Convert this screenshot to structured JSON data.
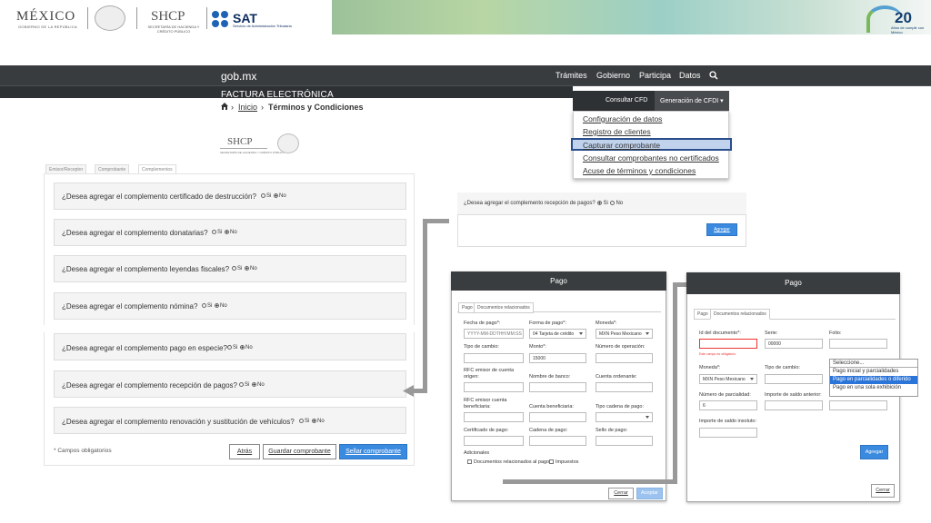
{
  "header": {
    "mexico": "MÉXICO",
    "mexico_sub": "GOBIERNO DE LA REPÚBLICA",
    "shcp": "SHCP",
    "shcp_sub": "SECRETARÍA DE HACIENDA Y CRÉDITO PÚBLICO",
    "sat": "SAT",
    "sat_sub": "Servicio de Administración Tributaria",
    "badge_num": "20",
    "badge_sub": "Años de cumplir con México"
  },
  "nav": {
    "brand": "gob.mx",
    "items": [
      "Trámites",
      "Gobierno",
      "Participa",
      "Datos"
    ],
    "subtitle": "FACTURA ELECTRÓNICA",
    "consultar": "Consultar CFD",
    "generacion": "Generación de CFDI ▾"
  },
  "breadcrumb": {
    "home": "Inicio",
    "current": "Términos y Condiciones"
  },
  "menu": {
    "items": [
      "Configuración de datos",
      "Registro de clientes",
      "Capturar comprobante",
      "Consultar comprobantes no certificados",
      "Acuse de términos y condiciones"
    ]
  },
  "small_logo": {
    "shcp": "SHCP",
    "sub": "SECRETARÍA DE HACIENDA Y CRÉDITO PÚBLICO"
  },
  "left_form": {
    "tabs": [
      "Emisor/Receptor",
      "Comprobante",
      "Complementos"
    ],
    "questions": [
      "¿Desea agregar el complemento certificado de destrucción?",
      "¿Desea agregar el complemento donatarias?",
      "¿Desea agregar el complemento leyendas fiscales?",
      "¿Desea agregar el complemento nómina?",
      "¿Desea agregar el complemento pago en especie?",
      "¿Desea agregar el complemento recepción de pagos?",
      "¿Desea agregar el complemento renovación y sustitución de vehículos?"
    ],
    "si": "Si",
    "no": "No",
    "required": "* Campos obligatorios",
    "btn_atras": "Atrás",
    "btn_guardar": "Guardar comprobante",
    "btn_sellar": "Sellar comprobante"
  },
  "recepcion": {
    "question": "¿Desea agregar el complemento recepción de pagos?",
    "si": "Si",
    "no": "No",
    "agregar": "Agregar"
  },
  "pago1": {
    "title": "Pago",
    "tabs": [
      "Pago",
      "Documentos relacionados"
    ],
    "fields": {
      "fecha_label": "Fecha de pago*:",
      "fecha_ph": "YYYY-MM-DDTHH:MM:SS",
      "forma_label": "Forma de pago*:",
      "forma_val": "04 Tarjeta de crédito",
      "moneda_label": "Moneda*:",
      "moneda_val": "MXN Peso Mexicano",
      "tipo_cambio_label": "Tipo de cambio:",
      "monto_label": "Monto*:",
      "monto_val": "15000",
      "num_op_label": "Número de operación:",
      "rfc_origen_label": "RFC emisor de cuenta origen:",
      "banco_label": "Nombre de banco:",
      "cuenta_ord_label": "Cuenta ordenante:",
      "rfc_benef_label": "RFC emisor cuenta beneficiaria:",
      "cuenta_benef_label": "Cuenta beneficiaria:",
      "tipo_cadena_label": "Tipo cadena de pago:",
      "cert_label": "Certificado de pago:",
      "cadena_label": "Cadena de pago:",
      "sello_label": "Sello de pago:"
    },
    "adicionales": "Adicionales",
    "chk_docs": "Documentos relacionados al pago",
    "chk_imp": "Impuestos",
    "cerrar": "Cerrar",
    "aceptar": "Aceptar"
  },
  "pago2": {
    "title": "Pago",
    "tabs": [
      "Pago",
      "Documentos relacionados"
    ],
    "id_doc_label": "Id del documento*:",
    "id_doc_hint": "Este campo es obligatorio",
    "serie_label": "Serie:",
    "serie_val": "00000",
    "folio_label": "Folio:",
    "moneda_label": "Moneda*:",
    "moneda_val": "MXN Peso Mexicano",
    "tipo_cambio_label": "Tipo de cambio:",
    "num_parc_label": "Número de parcialidad:",
    "num_parc_val": "6",
    "saldo_ant_label": "Importe de saldo anterior:",
    "saldo_ins_label": "Importe de saldo insoluto:",
    "agregar": "Agregar",
    "cerrar": "Cerrar",
    "options": [
      "Seleccione...",
      "Pago inicial y parcialidades",
      "Pago en parcialidades o diferido",
      "Pago en una sola exhibición"
    ],
    "selected_index": 2
  },
  "colors": {
    "nav": "#393c3e",
    "primary": "#3a8ae0",
    "menu_active": "#c0d2ec",
    "highlight": "#2b74d8"
  }
}
